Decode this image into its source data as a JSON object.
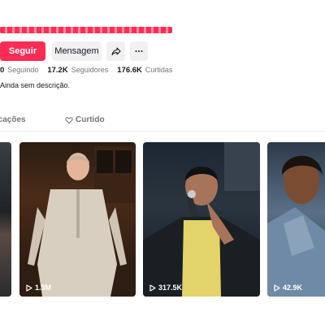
{
  "profile": {
    "follow_label": "Seguir",
    "message_label": "Mensagem",
    "stats": [
      {
        "value": "0",
        "label": "Seguindo"
      },
      {
        "value": "17.2K",
        "label": "Seguidores"
      },
      {
        "value": "176.6K",
        "label": "Curtidas"
      }
    ],
    "bio": "Ainda sem descrição."
  },
  "tabs": [
    {
      "label": "blicações"
    },
    {
      "label": "Curtido"
    }
  ],
  "videos": [
    {
      "views": ""
    },
    {
      "views": "1.3M"
    },
    {
      "views": "317.5K"
    },
    {
      "views": "42.9K"
    }
  ],
  "colors": {
    "accent": "#fe2c55",
    "secondary_button": "#f1f1f2",
    "muted_text": "#73757c"
  }
}
